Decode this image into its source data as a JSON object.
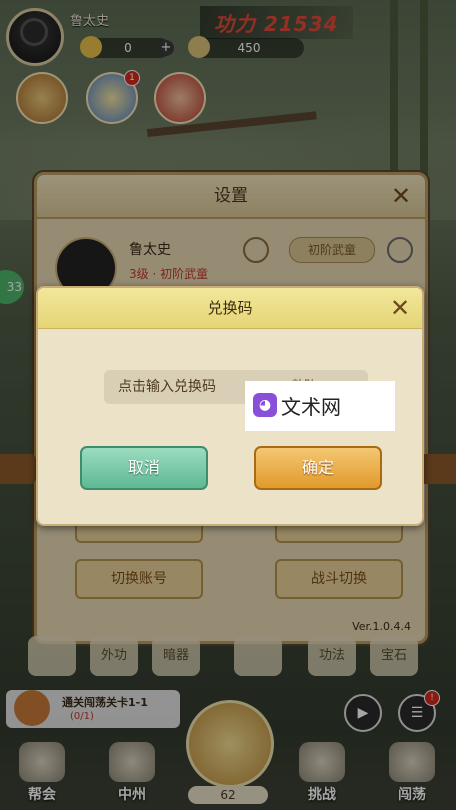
{
  "hud": {
    "player_name": "鲁太史",
    "power": "功力 21534",
    "gold": "0",
    "silver": "450",
    "events": [
      {
        "label": "",
        "badge": ""
      },
      {
        "label": "",
        "badge": "1"
      },
      {
        "label": "",
        "badge": ""
      }
    ]
  },
  "left_side": {
    "counter": "33"
  },
  "settings": {
    "title": "设置",
    "player_name": "鲁太史",
    "level": "3级 · 初阶武童",
    "rank": "初阶武童",
    "buttons": [
      "",
      "",
      "切换账号",
      "战斗切换"
    ],
    "version": "Ver.1.0.4.4"
  },
  "dialog": {
    "title": "兑换码",
    "placeholder": "点击输入兑换码",
    "paste_label": "粘贴",
    "cancel": "取消",
    "confirm": "确定"
  },
  "watermark": {
    "text": "文术网"
  },
  "bottom_row": [
    "",
    "外功",
    "暗器",
    "",
    "功法",
    "宝石"
  ],
  "task": {
    "title": "通关闯荡关卡1-1",
    "progress": "(0/1)"
  },
  "stamina": "62",
  "nav": [
    "帮会",
    "中州",
    "挑战",
    "闯荡"
  ],
  "colors": {
    "accent_orange": "#e09a2c",
    "accent_green": "#5fb894",
    "power_red": "#e04a3a"
  }
}
